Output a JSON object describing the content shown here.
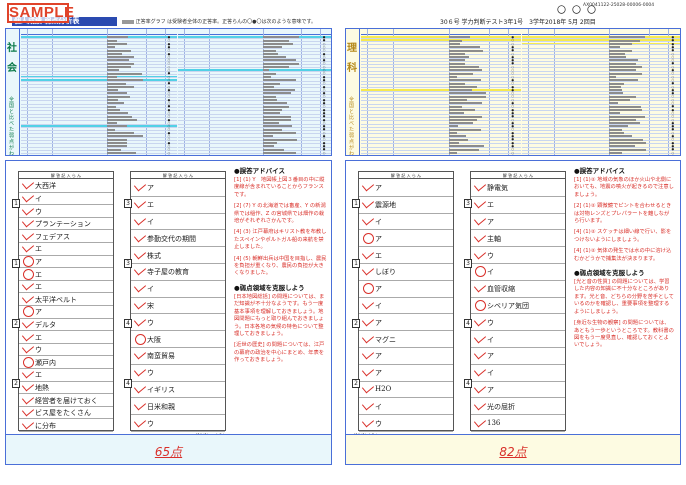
{
  "header": {
    "watermark": "SAMPLE",
    "doc_title": "個人成績 弱点分析表",
    "legend_note": "正答率グラフ は受験者全体の正答率。正答らんの〇●〇は次のような意味です。",
    "circles": "〇〇〇",
    "doc_id": "AX0041122-25028-00006-0004",
    "exam_title": "30６号 学力判断テスト3年1号　3学年2018年 5月 2回目"
  },
  "left": {
    "subject_char_1": "社",
    "subject_char_2": "会",
    "subject_vertical": "全国と比べた弱点がわかります",
    "score": "65点",
    "advice_title": "●誤答アドバイス",
    "advice": [
      "[1] (1) Y　地図帳上図３番目の中に縦度線が含まれていることからフランスです。",
      "[2] (7) Y の北海道では畜産、Y の新潟県では稲作、Z の宮城県では畑作の栽培がそれぞれさかんです。",
      "[4] (3) 江戸幕府はキリスト教を布教したスペインやポルトガル船の来航を禁止しました。",
      "[4] (5) 朝鮮出兵は中国を目指し、農民を負担が重くなり、農民の負担が大きくなりました。"
    ],
    "weak_title": "●弱点領域を克服しよう",
    "weak": [
      "[日本地図総括] の問題については、まだ知識が不十分なようです。もう一度基本事項を理解しておきましょう。地図問題にもっと取り組んでおきましょう。日本各地の気候の特色について整理しておきましょう。",
      "[近世の歴史] の問題については、江戸の幕府の政治を中心にまとめ、年表を作っておきましょう。"
    ],
    "answers_col1": [
      "大西洋",
      "イ",
      "ウ",
      "プランテーション",
      "フェデアス",
      "エ",
      "ア",
      "エ",
      "エ",
      "太平洋ベルト",
      "ア",
      "デルタ",
      "エ",
      "ウ",
      "瀬戸内",
      "エ",
      "地熱",
      "経営者を届けておく",
      "ビス屋をたくさん",
      "に分布"
    ],
    "answers_col2": [
      "ア",
      "エ",
      "イ",
      "参勤交代の期間",
      "株式",
      "寺子屋の教育",
      "イ",
      "宋",
      "ウ",
      "大阪",
      "南蛮貿易",
      "ウ",
      "イギリス",
      "日米和親",
      "ウ"
    ],
    "foot_1": "[1] (1)-@ 各2点",
    "foot_2": "その他 各3点"
  },
  "right": {
    "subject_char_1": "理",
    "subject_char_2": "科",
    "subject_vertical": "全国と比べた弱点がわかります",
    "score": "82点",
    "advice_title": "●誤答アドバイス",
    "advice": [
      "[1] (1)② 地域の気象のほか火山や北側においても、地震の噴火が起きるので注意しましょう。",
      "[2] (1)② 顕微鏡でピントを合わせるときは対物レンズとプレパラートを離しながら行います。",
      "[4] (1)② スケッチは細い線で行い、影をつけないようにしましょう。",
      "[4] (1)② 気体の発生では水の中に溶け込むかどうかで捕集法が決まります。"
    ],
    "weak_title": "●弱点領域を克服しよう",
    "weak": [
      "[光と音の性質] の問題については、学習した内容の知識に不十分なところがあります。光と音、どちらの分野を苦手としているのかを確認し、重要事項を整理するようにしましょう。",
      "[身近な生物の観察] の問題については、あともう一歩というところです。教科書の図をもう一度見直し、確認しておくとよいでしょう。"
    ],
    "answers_col1": [
      "ア",
      "震源地",
      "イ",
      "ア",
      "エ",
      "しぼり",
      "ア",
      "イ",
      "ア",
      "マグニ",
      "ア",
      "ア",
      "H2O",
      "イ",
      "ウ"
    ],
    "answers_col2": [
      "静電気",
      "エ",
      "ア",
      "主軸",
      "ウ",
      "イ",
      "血管収縮",
      "シベリア気団",
      "ウ",
      "イ",
      "ア",
      "イ",
      "ア",
      "光の屈折",
      "136"
    ],
    "foot_1": "[1] (1) 各2点",
    "foot_2": "その他 各3点"
  },
  "colors": {
    "accent_blue": "#4a6fd8",
    "left_highlight": "#52d1e6",
    "right_highlight": "#f6ea4d",
    "mark_red": "#d9302a"
  }
}
